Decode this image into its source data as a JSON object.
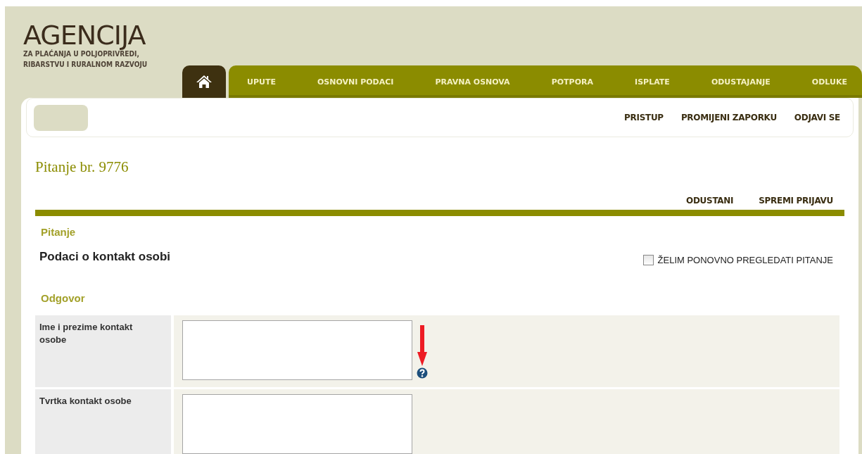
{
  "logo": {
    "title": "AGENCIJA",
    "subtitle_lines": [
      "ZA PLAĆANJA U POLJOPRIVREDI,",
      "RIBARSTVU I RURALNOM RAZVOJU"
    ]
  },
  "nav": {
    "home_selected": true,
    "items": [
      {
        "label": "UPUTE",
        "selected": false
      },
      {
        "label": "OSNOVNI PODACI",
        "selected": false
      },
      {
        "label": "PRAVNA OSNOVA",
        "selected": false
      },
      {
        "label": "POTPORA",
        "selected": false
      },
      {
        "label": "ISPLATE",
        "selected": false
      },
      {
        "label": "ODUSTAJANJE",
        "selected": false
      },
      {
        "label": "ODLUKE",
        "selected": false
      }
    ]
  },
  "user_menu": [
    "PRISTUP",
    "PROMIJENI ZAPORKU",
    "ODJAVI SE"
  ],
  "page_title": "Pitanje br. 9776",
  "actions": [
    "ODUSTANI",
    "SPREMI PRIJAVU"
  ],
  "question": {
    "heading": "Pitanje",
    "text": "Podaci o kontakt osobi",
    "review_checkbox": {
      "label": "ŽELIM PONOVNO PREGLEDATI PITANJE",
      "checked": false
    }
  },
  "answer": {
    "heading": "Odgovor",
    "fields": [
      {
        "label": "Ime i prezime kontakt osobe",
        "help": true
      },
      {
        "label": "Tvrtka kontakt osobe",
        "help": false
      }
    ]
  }
}
